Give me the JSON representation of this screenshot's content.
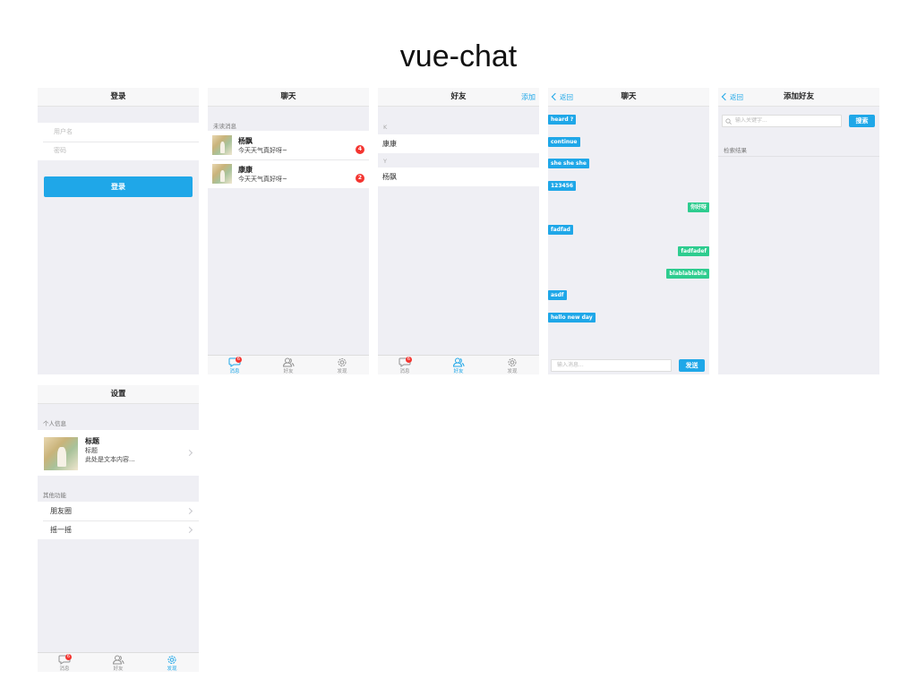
{
  "title": "vue-chat",
  "login": {
    "nav_title": "登录",
    "username_placeholder": "用户名",
    "password_placeholder": "密码",
    "login_button": "登录"
  },
  "chats": {
    "nav_title": "聊天",
    "section_label": "未读消息",
    "items": [
      {
        "name": "杨飘",
        "message": "今天天气真好呀~",
        "unread": "4"
      },
      {
        "name": "康康",
        "message": "今天天气真好呀~",
        "unread": "2"
      }
    ]
  },
  "friends": {
    "nav_title": "好友",
    "add_label": "添加",
    "groups": [
      {
        "letter": "K",
        "name": "康康"
      },
      {
        "letter": "Y",
        "name": "杨飘"
      }
    ]
  },
  "conversation": {
    "nav_title": "聊天",
    "back_label": "返回",
    "messages": [
      {
        "text": "heard ?",
        "side": "in"
      },
      {
        "text": "continue",
        "side": "in"
      },
      {
        "text": "she she she",
        "side": "in"
      },
      {
        "text": "123456",
        "side": "in"
      },
      {
        "text": "你好呀",
        "side": "out"
      },
      {
        "text": "fadfad",
        "side": "in"
      },
      {
        "text": "fadfadef",
        "side": "out"
      },
      {
        "text": "blablablabla",
        "side": "out"
      },
      {
        "text": "asdf",
        "side": "in"
      },
      {
        "text": "hello new day",
        "side": "in"
      }
    ],
    "input_placeholder": "输入消息...",
    "send_button": "发送"
  },
  "add_friend": {
    "nav_title": "添加好友",
    "back_label": "返回",
    "search_placeholder": "输入关键字...",
    "search_button": "搜索",
    "results_label": "检索结果"
  },
  "settings": {
    "nav_title": "设置",
    "personal_label": "个人信息",
    "profile": {
      "title": "标题",
      "subtitle": "标题",
      "desc": "此处是文本内容..."
    },
    "other_label": "其他功能",
    "items": [
      "朋友圈",
      "摇一摇"
    ]
  },
  "tabbar": {
    "tabs": [
      "消息",
      "好友",
      "发现"
    ],
    "message_badge": "6"
  },
  "colors": {
    "accent": "#1fa7e8",
    "outgoing": "#2ecc8f",
    "badge": "#f43530"
  }
}
